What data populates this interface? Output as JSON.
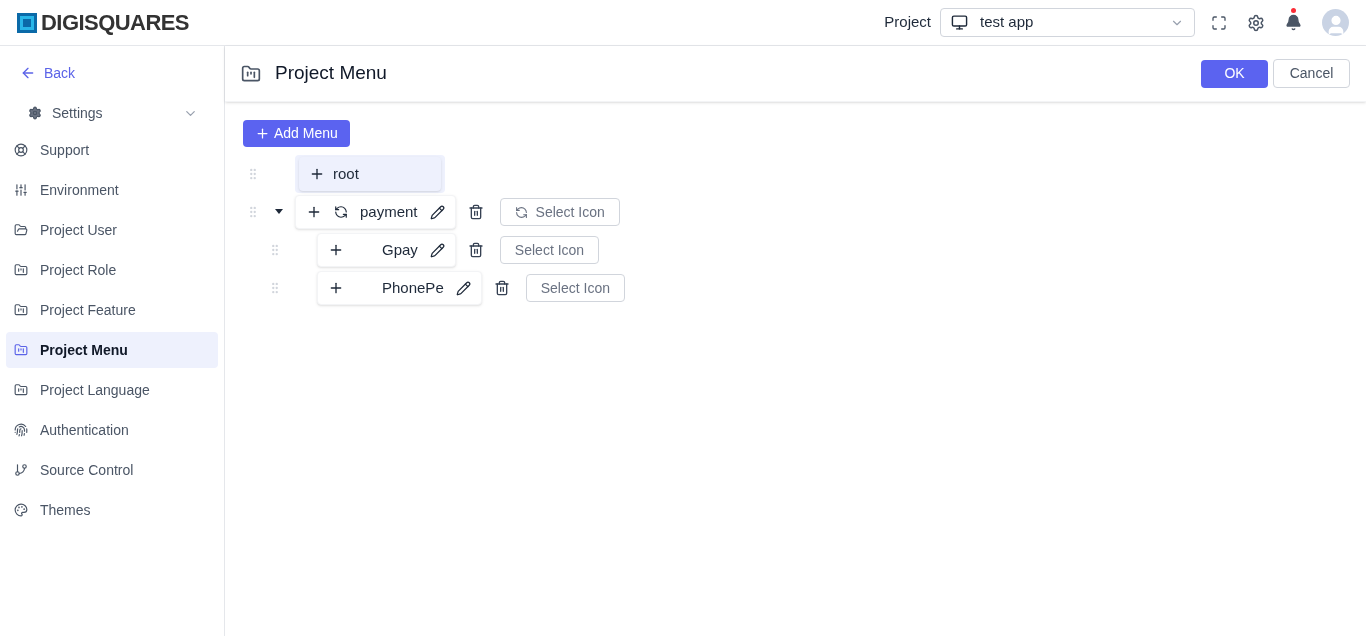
{
  "brand": "DIGISQUARES",
  "header": {
    "project_label": "Project",
    "project_value": "test app",
    "notification": true
  },
  "sidebar": {
    "back": "Back",
    "group": {
      "label": "Settings",
      "expanded": true
    },
    "items": [
      {
        "label": "Support",
        "selected": false
      },
      {
        "label": "Environment",
        "selected": false
      },
      {
        "label": "Project User",
        "selected": false
      },
      {
        "label": "Project Role",
        "selected": false
      },
      {
        "label": "Project Feature",
        "selected": false
      },
      {
        "label": "Project Menu",
        "selected": true
      },
      {
        "label": "Project Language",
        "selected": false
      },
      {
        "label": "Authentication",
        "selected": false
      },
      {
        "label": "Source Control",
        "selected": false
      },
      {
        "label": "Themes",
        "selected": false
      }
    ]
  },
  "page": {
    "title": "Project Menu",
    "ok": "OK",
    "cancel": "Cancel",
    "add": "Add Menu"
  },
  "tree": [
    {
      "kind": "root",
      "label": "root"
    },
    {
      "kind": "item",
      "label": "payment",
      "has_icon": true,
      "expanded": true,
      "select_label": "Select Icon",
      "children": [
        {
          "kind": "item",
          "label": "Gpay",
          "has_icon": false,
          "select_label": "Select Icon"
        },
        {
          "kind": "item",
          "label": "PhonePe",
          "has_icon": false,
          "select_label": "Select Icon"
        }
      ]
    }
  ]
}
